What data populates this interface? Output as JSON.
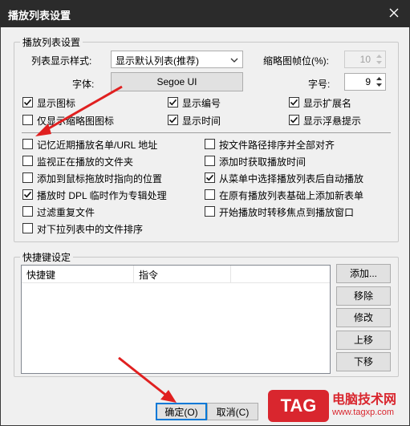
{
  "window": {
    "title": "播放列表设置"
  },
  "playlist_group": {
    "legend": "播放列表设置",
    "display_style_label": "列表显示样式:",
    "display_style_value": "显示默认列表(推荐)",
    "thumb_fps_label": "缩略图帧位(%):",
    "thumb_fps_value": "10",
    "font_label": "字体:",
    "font_value": "Segoe UI",
    "font_size_label": "字号:",
    "font_size_value": "9",
    "checkboxes_row1": [
      {
        "label": "显示图标",
        "checked": true
      },
      {
        "label": "显示编号",
        "checked": true
      },
      {
        "label": "显示扩展名",
        "checked": true
      }
    ],
    "checkboxes_row2": [
      {
        "label": "仅显示缩略图图标",
        "checked": false
      },
      {
        "label": "显示时间",
        "checked": true
      },
      {
        "label": "显示浮悬提示",
        "checked": true
      }
    ],
    "options_left": [
      {
        "label": "记忆近期播放名单/URL 地址",
        "checked": false
      },
      {
        "label": "监视正在播放的文件夹",
        "checked": false
      },
      {
        "label": "添加到鼠标拖放时指向的位置",
        "checked": false
      },
      {
        "label": "播放时 DPL 临时作为专辑处理",
        "checked": true
      },
      {
        "label": "过滤重复文件",
        "checked": false
      },
      {
        "label": "对下拉列表中的文件排序",
        "checked": false
      }
    ],
    "options_right": [
      {
        "label": "按文件路径排序并全部对齐",
        "checked": false
      },
      {
        "label": "添加时获取播放时间",
        "checked": false
      },
      {
        "label": "从菜单中选择播放列表后自动播放",
        "checked": true
      },
      {
        "label": "在原有播放列表基础上添加新表单",
        "checked": false
      },
      {
        "label": "开始播放时转移焦点到播放窗口",
        "checked": false
      }
    ]
  },
  "shortcut_group": {
    "legend": "快捷键设定",
    "columns": [
      "快捷键",
      "指令"
    ],
    "buttons": [
      "添加...",
      "移除",
      "修改",
      "上移",
      "下移"
    ]
  },
  "footer": {
    "ok_label": "确定(O)",
    "cancel_label": "取消(C)"
  },
  "watermark": {
    "tag": "TAG",
    "name": "电脑技术网",
    "url": "www.tagxp.com"
  },
  "colors": {
    "titlebar": "#2b2b2b",
    "dialog_bg": "#f0f0f0",
    "annotation_arrow": "#e02020",
    "watermark_red": "#d9262e",
    "focus_blue": "#0078d7"
  }
}
